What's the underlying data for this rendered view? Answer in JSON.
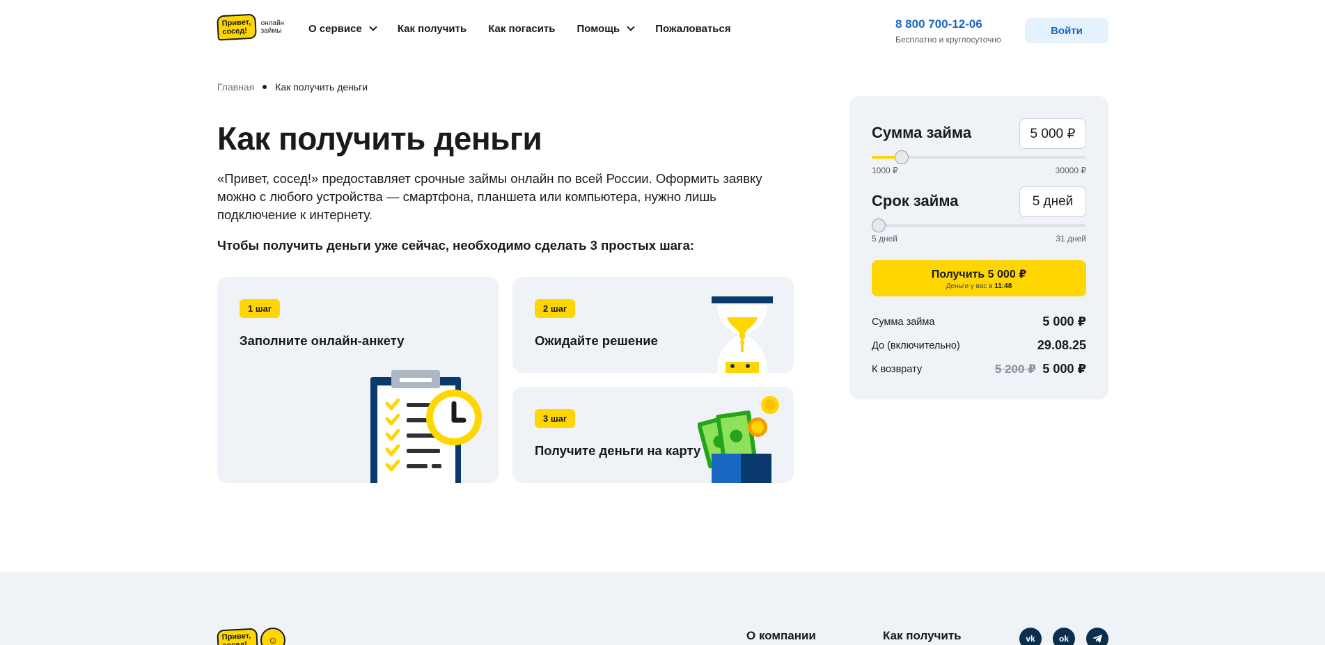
{
  "header": {
    "logo_text": "Привет, сосед!",
    "logo_sub": "онлайн займы",
    "nav": [
      {
        "label": "О сервисе",
        "dropdown": true
      },
      {
        "label": "Как получить",
        "dropdown": false
      },
      {
        "label": "Как погасить",
        "dropdown": false
      },
      {
        "label": "Помощь",
        "dropdown": true
      },
      {
        "label": "Пожаловаться",
        "dropdown": false
      }
    ],
    "phone": "8 800 700-12-06",
    "phone_sub": "Бесплатно и круглосуточно",
    "login_label": "Войти"
  },
  "breadcrumb": {
    "home": "Главная",
    "current": "Как получить деньги"
  },
  "main": {
    "title": "Как получить деньги",
    "intro": "«Привет, сосед!» предоставляет срочные займы онлайн по всей России. Оформить заявку можно с любого устройства — смартфона, планшета или компьютера, нужно лишь подключение к интернету.",
    "steps_title": "Чтобы получить деньги уже сейчас, необходимо сделать 3 простых шага:",
    "steps": [
      {
        "badge": "1 шаг",
        "text": "Заполните онлайн-анкету"
      },
      {
        "badge": "2 шаг",
        "text": "Ожидайте решение"
      },
      {
        "badge": "3 шаг",
        "text": "Получите деньги на карту"
      }
    ]
  },
  "calculator": {
    "amount_label": "Сумма займа",
    "amount_value": "5 000 ₽",
    "amount_min": "1000 ₽",
    "amount_max": "30000 ₽",
    "amount_fraction": 0.138,
    "term_label": "Срок займа",
    "term_value": "5 дней",
    "term_min": "5 дней",
    "term_max": "31 дней",
    "term_fraction": 0.0,
    "cta_label": "Получить 5 000 ₽",
    "cta_sub_prefix": "Деньги у вас в",
    "cta_sub_time": "11:48",
    "summary": [
      {
        "label": "Сумма займа",
        "value": "5 000 ₽",
        "old": ""
      },
      {
        "label": "До (включительно)",
        "value": "29.08.25",
        "old": ""
      },
      {
        "label": "К возврату",
        "value": "5 000 ₽",
        "old": "5 200 ₽"
      }
    ]
  },
  "footer": {
    "logo_text": "Привет, сосед!",
    "links": [
      "О компании",
      "Как получить"
    ],
    "social": [
      "vk-icon",
      "ok-icon",
      "telegram-icon"
    ]
  },
  "colors": {
    "accent": "#ffd600",
    "link_blue": "#1867c0",
    "card_bg": "#eff2f6",
    "navy": "#0a2e4d"
  }
}
